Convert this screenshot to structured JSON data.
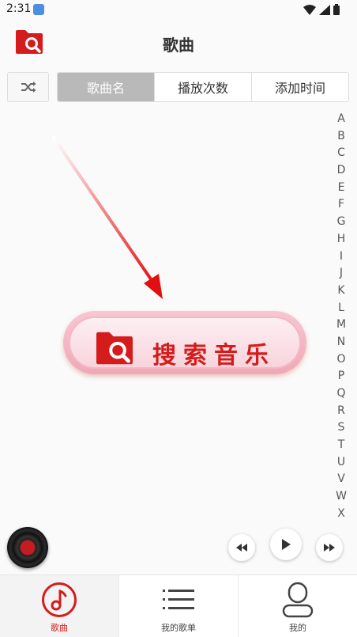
{
  "status_bar": {
    "time": "2:31"
  },
  "header": {
    "title": "歌曲"
  },
  "sort_tabs": [
    {
      "label": "歌曲名",
      "active": true
    },
    {
      "label": "播放次数",
      "active": false
    },
    {
      "label": "添加时间",
      "active": false
    }
  ],
  "alphabet_index": [
    "A",
    "B",
    "C",
    "D",
    "E",
    "F",
    "G",
    "H",
    "I",
    "J",
    "K",
    "L",
    "M",
    "N",
    "O",
    "P",
    "Q",
    "R",
    "S",
    "T",
    "U",
    "V",
    "W",
    "X"
  ],
  "search_music": {
    "label": "搜索音乐"
  },
  "bottom_nav": [
    {
      "label": "歌曲",
      "icon": "music-note-icon",
      "active": true
    },
    {
      "label": "我的歌单",
      "icon": "playlist-icon",
      "active": false
    },
    {
      "label": "我的",
      "icon": "person-icon",
      "active": false
    }
  ],
  "colors": {
    "accent": "#d41c1c",
    "active_tab": "#b9b9b9",
    "background": "#fafafa"
  }
}
